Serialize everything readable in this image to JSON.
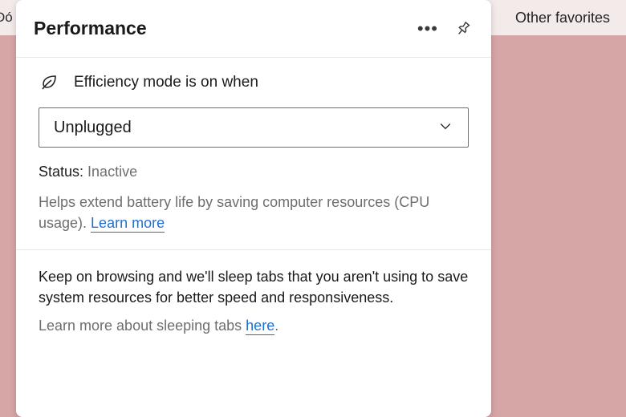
{
  "favorites_bar": {
    "left_fragment": "Đó",
    "other_favorites": "Other favorites"
  },
  "panel": {
    "title": "Performance",
    "efficiency": {
      "label": "Efficiency mode is on when",
      "dropdown_value": "Unplugged",
      "status_label": "Status:",
      "status_value": "Inactive",
      "description_prefix": "Helps extend battery life by saving computer resources (CPU usage). ",
      "learn_more": "Learn more"
    },
    "sleeping_tabs": {
      "text": "Keep on browsing and we'll sleep tabs that you aren't using to save system resources for better speed and responsiveness.",
      "learn_prefix": "Learn more about sleeping tabs ",
      "learn_link": "here",
      "learn_suffix": "."
    }
  }
}
